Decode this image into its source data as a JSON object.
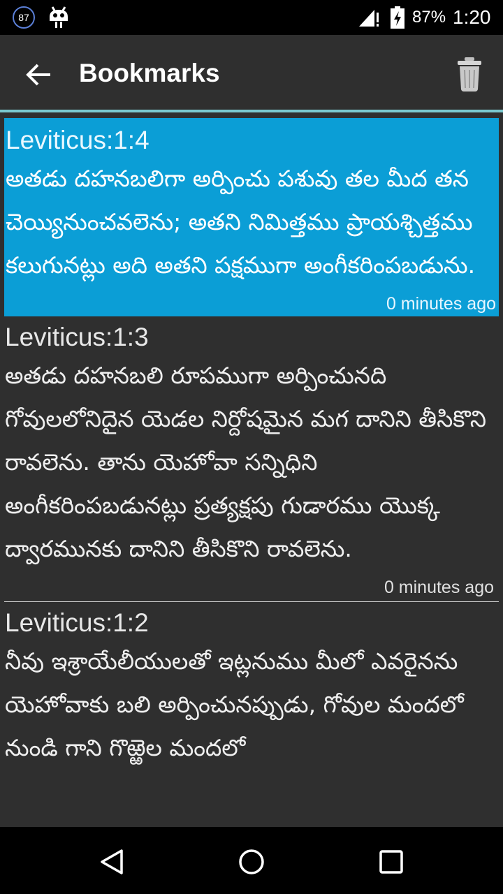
{
  "status_bar": {
    "badge": "87",
    "battery_pct": "87%",
    "time": "1:20",
    "icons": [
      "notification-badge-icon",
      "android-icon",
      "signal-icon",
      "battery-charging-icon"
    ]
  },
  "app_bar": {
    "title": "Bookmarks",
    "back_icon": "arrow-back-icon",
    "action_icon": "trash-icon"
  },
  "bookmarks": [
    {
      "ref": "Leviticus:1:4",
      "text": "అతడు దహనబలిగా అర్పించు పశువు తల మీద తన చెయ్యినుంచవలెను; అతని నిమిత్తము ప్రాయశ్చిత్తము కలుగునట్లు అది అతని పక్షముగా అంగీకరింపబడును.",
      "time": "0 minutes ago",
      "selected": true
    },
    {
      "ref": "Leviticus:1:3",
      "text": "అతడు దహనబలి రూపముగా అర్పించునది గోవులలోనిదైన యెడల నిర్దోషమైన మగ దానిని తీసికొని రావలెను. తాను యెహోవా సన్నిధిని అంగీకరింపబడునట్లు ప్రత్యక్షపు గుడారము యొక్క ద్వారమునకు దానిని తీసికొని రావలెను.",
      "time": "0 minutes ago",
      "selected": false
    },
    {
      "ref": "Leviticus:1:2",
      "text": "నీవు ఇశ్రాయేలీయులతో ఇట్లనుము మీలో ఎవరైనను యెహోవాకు బలి అర్పించునప్పుడు, గోవుల మందలో నుండి గాని గొఱ్ఱెల మందలో",
      "time": "",
      "selected": false
    }
  ],
  "colors": {
    "selected_bg": "#0b9ed6",
    "background": "#2f2f2f",
    "accent_line": "#7ac8cf"
  },
  "nav_bar": {
    "icons": [
      "back-triangle-icon",
      "home-circle-icon",
      "recents-square-icon"
    ]
  }
}
